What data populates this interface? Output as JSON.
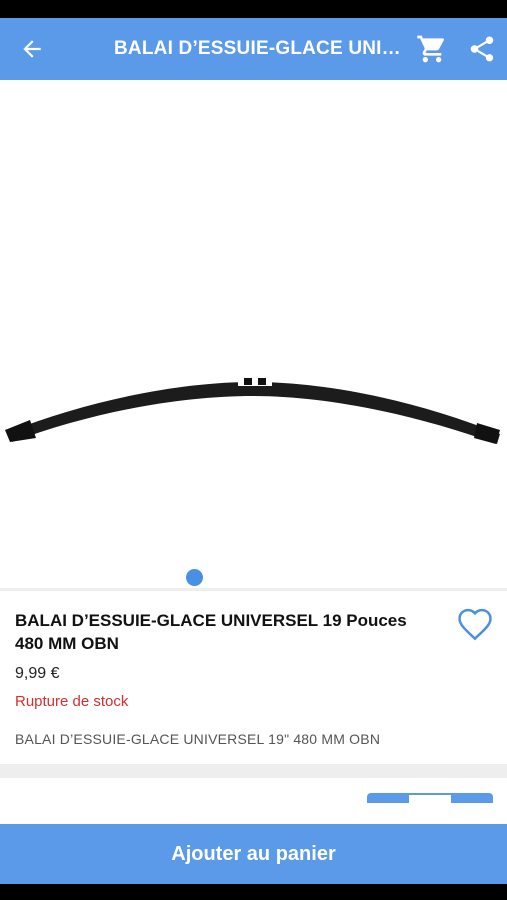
{
  "header": {
    "title": "BALAI D’ESSUIE-GLACE UNIVERSEL 19 Pouces 480 MM OBN",
    "back_icon": "arrow-left-icon",
    "cart_icon": "cart-icon",
    "share_icon": "share-icon"
  },
  "gallery": {
    "image": "wiper-blade",
    "active_index": 1,
    "total": 1
  },
  "product": {
    "name": "BALAI D’ESSUIE-GLACE UNIVERSEL 19 Pouces 480 MM OBN",
    "price": "9,99 €",
    "stock_status": "Rupture de stock",
    "description": "BALAI D’ESSUIE-GLACE UNIVERSEL 19\" 480 MM OBN",
    "favorite_icon": "heart-outline-icon"
  },
  "actions": {
    "add_to_cart_label": "Ajouter au panier"
  },
  "colors": {
    "primary": "#5b9ae8",
    "stock_out": "#d32f2f"
  }
}
